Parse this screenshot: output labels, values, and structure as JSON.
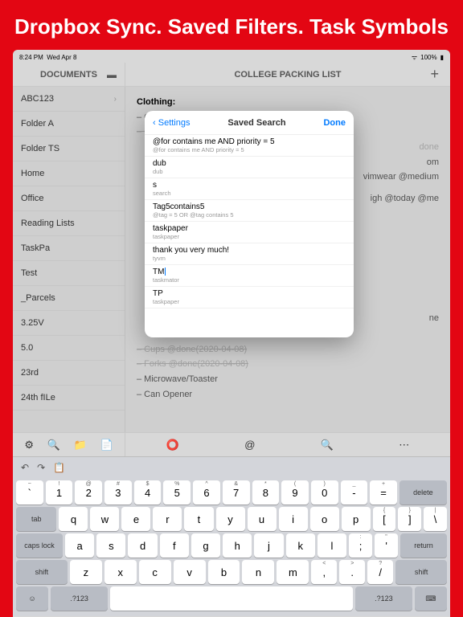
{
  "headline": "Dropbox Sync. Saved Filters. Task Symbols",
  "statusbar": {
    "time": "8:24 PM",
    "date": "Wed Apr 8",
    "battery": "100%"
  },
  "toolbar": {
    "left_title": "DOCUMENTS",
    "right_title": "COLLEGE PACKING LIST",
    "plus": "+"
  },
  "sidebar": {
    "items": [
      {
        "label": "ABC123",
        "chevron": true
      },
      {
        "label": "Folder A"
      },
      {
        "label": "Folder TS"
      },
      {
        "label": "Home"
      },
      {
        "label": "Office"
      },
      {
        "label": "Reading Lists"
      },
      {
        "label": "TaskPa"
      },
      {
        "label": "Test"
      },
      {
        "label": "_Parcels"
      },
      {
        "label": "3.25V"
      },
      {
        "label": "5.0"
      },
      {
        "label": "23rd"
      },
      {
        "label": "24th fILe"
      }
    ]
  },
  "document": {
    "section1": "Clothing:",
    "lines_top": [
      {
        "text": "– Casual shirts/T-shirts @high @me",
        "done": false
      },
      {
        "text": "– Casual pants/ Shorts @high @me @done",
        "done": true
      }
    ],
    "frag1": "done",
    "frag2": "om",
    "frag3": "vimwear @medium",
    "frag4": "igh @today @me",
    "frag5": "ne",
    "lines_bottom": [
      {
        "text": "– Cups @done(2020-04-08)",
        "done": true
      },
      {
        "text": "– Forks @done(2020-04-08)",
        "done": true
      },
      {
        "text": "– Microwave/Toaster",
        "done": false
      },
      {
        "text": "– Can Opener",
        "done": false
      }
    ]
  },
  "modal": {
    "back": "Settings",
    "title": "Saved Search",
    "done": "Done",
    "items": [
      {
        "name": "@for contains me AND priority = 5",
        "query": "@for contains me AND priority = 5"
      },
      {
        "name": "dub",
        "query": "dub"
      },
      {
        "name": "s",
        "query": "search"
      },
      {
        "name": "Tag5contains5",
        "query": "@tag = 5 OR @tag contains 5"
      },
      {
        "name": "taskpaper",
        "query": "taskpaper"
      },
      {
        "name": "thank you very much!",
        "query": "tyvm"
      },
      {
        "name": "TM",
        "query": "taskmator",
        "editing": true
      },
      {
        "name": "TP",
        "query": "taskpaper"
      }
    ]
  },
  "bottombar_left": [
    "⚙",
    "🔍",
    "📁",
    "📄"
  ],
  "bottombar_right": [
    "⭕",
    "@",
    "🔍",
    "⋯"
  ],
  "keyboard": {
    "row0_upper": [
      "~",
      "!",
      "@",
      "#",
      "$",
      "%",
      "^",
      "&",
      "*",
      "(",
      ")",
      "_",
      "+"
    ],
    "row0": [
      "`",
      "1",
      "2",
      "3",
      "4",
      "5",
      "6",
      "7",
      "8",
      "9",
      "0",
      "-",
      "="
    ],
    "delete": "delete",
    "tab": "tab",
    "row1": [
      "q",
      "w",
      "e",
      "r",
      "t",
      "y",
      "u",
      "i",
      "o",
      "p"
    ],
    "row1_end_upper": [
      "{",
      "}",
      "|"
    ],
    "row1_end": [
      "[",
      "]",
      "\\"
    ],
    "caps": "caps lock",
    "row2": [
      "a",
      "s",
      "d",
      "f",
      "g",
      "h",
      "j",
      "k",
      "l"
    ],
    "row2_end_upper": [
      ":",
      "\""
    ],
    "row2_end": [
      ";",
      "'"
    ],
    "return": "return",
    "shift": "shift",
    "row3": [
      "z",
      "x",
      "c",
      "v",
      "b",
      "n",
      "m"
    ],
    "row3_end_upper": [
      "<",
      ">",
      "?"
    ],
    "row3_end": [
      ",",
      ".",
      "/"
    ],
    "globe": "☺",
    "numkey": ".?123",
    "dismiss": "⌨"
  }
}
